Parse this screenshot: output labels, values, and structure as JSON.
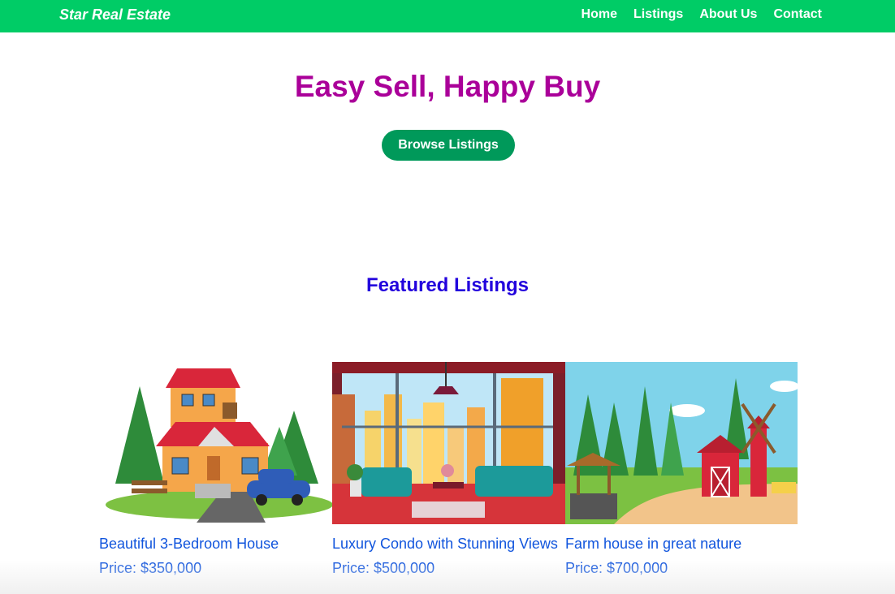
{
  "nav": {
    "brand": "Star Real Estate",
    "links": [
      "Home",
      "Listings",
      "About Us",
      "Contact"
    ]
  },
  "hero": {
    "title": "Easy Sell, Happy Buy",
    "button": "Browse Listings"
  },
  "featured": {
    "title": "Featured Listings",
    "listings": [
      {
        "title": "Beautiful 3-Bedroom House",
        "price": "Price: $350,000",
        "image": "house-illustration"
      },
      {
        "title": "Luxury Condo with Stunning Views",
        "price": "Price: $500,000",
        "image": "condo-interior-illustration"
      },
      {
        "title": "Farm house in great nature",
        "price": "Price: $700,000",
        "image": "farm-illustration"
      }
    ]
  },
  "colors": {
    "navbar": "#00cc66",
    "hero_title": "#aa0099",
    "button": "#00995a",
    "section_title": "#2200dd",
    "link": "#1155dd"
  }
}
